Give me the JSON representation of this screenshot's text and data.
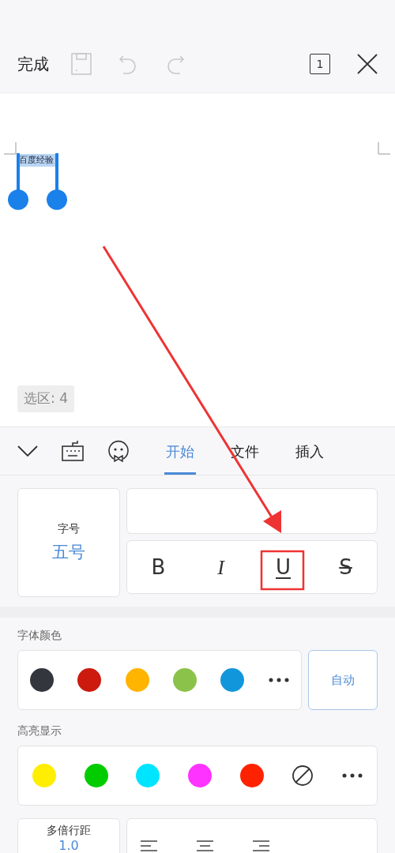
{
  "toolbar": {
    "done": "完成",
    "save_disabled": true,
    "undo_disabled": true,
    "redo_disabled": true,
    "page_count": "1"
  },
  "document": {
    "selected_text": "百度经验",
    "selection_info": "选区: 4"
  },
  "tabs": [
    {
      "label": "开始",
      "selected": true
    },
    {
      "label": "文件",
      "selected": false
    },
    {
      "label": "插入",
      "selected": false
    }
  ],
  "font_size": {
    "label": "字号",
    "value": "五号"
  },
  "format_buttons": [
    {
      "kind": "bold",
      "label": "B"
    },
    {
      "kind": "italic",
      "label": "I"
    },
    {
      "kind": "underline",
      "label": "U"
    },
    {
      "kind": "strike",
      "label": "S"
    }
  ],
  "font_color": {
    "label": "字体颜色",
    "swatches": [
      {
        "color": "#33363d"
      },
      {
        "color": "#cc1a0e"
      },
      {
        "color": "#ffb400"
      },
      {
        "color": "#8bc34a"
      },
      {
        "color": "#1296db"
      }
    ],
    "auto": "自动"
  },
  "highlight": {
    "label": "高亮显示",
    "swatches": [
      {
        "color": "#ffee00"
      },
      {
        "color": "#00cc00"
      },
      {
        "color": "#00e5ff"
      },
      {
        "color": "#ff33ff"
      },
      {
        "color": "#ff2200"
      }
    ]
  },
  "line_spacing": {
    "label": "多倍行距",
    "value": "1.0"
  }
}
